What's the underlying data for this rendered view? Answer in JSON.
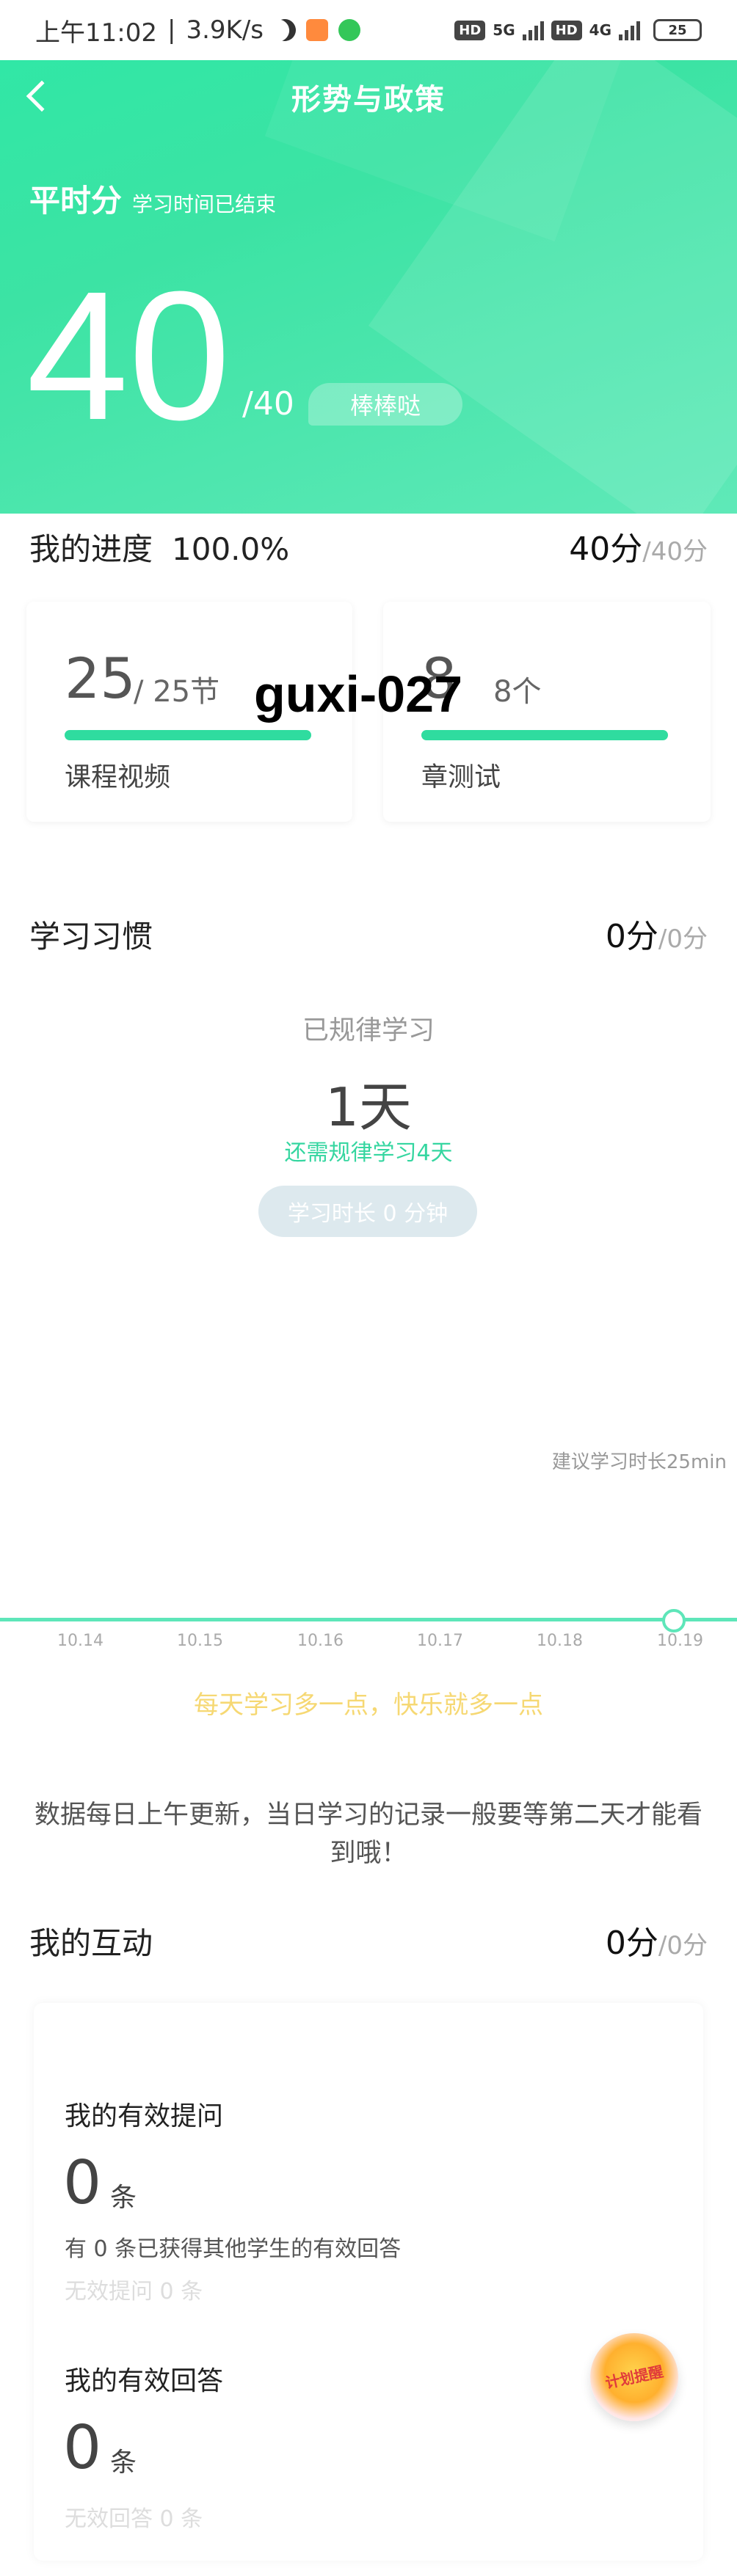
{
  "status_bar": {
    "time": "上午11:02",
    "speed": "3.9K/s",
    "network_1": "5G",
    "network_2": "4G",
    "battery": "25"
  },
  "header": {
    "title": "形势与政策"
  },
  "score": {
    "label": "平时分",
    "sub_label": "学习时间已结束",
    "value": "40",
    "total": "/40",
    "praise": "棒棒哒"
  },
  "progress": {
    "title": "我的进度",
    "percent": "100.0%",
    "score": "40分",
    "score_total": "/40分",
    "video": {
      "count": "25",
      "unit": "/ 25节",
      "label": "课程视频",
      "fill": 1.0
    },
    "test": {
      "count": "8",
      "unit": "8个",
      "label": "章测试",
      "fill": 1.0
    }
  },
  "watermark": "guxi-027",
  "habit": {
    "title": "学习习惯",
    "score": "0分",
    "score_total": "/0分",
    "regular_label": "已规律学习",
    "days": "1天",
    "needed": "还需规律学习4天",
    "duration": "学习时长 0 分钟",
    "suggest": "建议学习时长25min",
    "ticks": [
      "10.14",
      "10.15",
      "10.16",
      "10.17",
      "10.18",
      "10.19"
    ],
    "motto": "每天学习多一点，快乐就多一点"
  },
  "notice": "数据每日上午更新，当日学习的记录一般要等第二天才能看到哦！",
  "interaction": {
    "title": "我的互动",
    "score": "0分",
    "score_total": "/0分",
    "questions": {
      "title": "我的有效提问",
      "count": "0",
      "unit": "条",
      "desc": "有 0 条已获得其他学生的有效回答",
      "invalid": "无效提问 0 条"
    },
    "answers": {
      "title": "我的有效回答",
      "count": "0",
      "unit": "条",
      "invalid": "无效回答 0 条"
    }
  },
  "badge_text": "计划提醒"
}
